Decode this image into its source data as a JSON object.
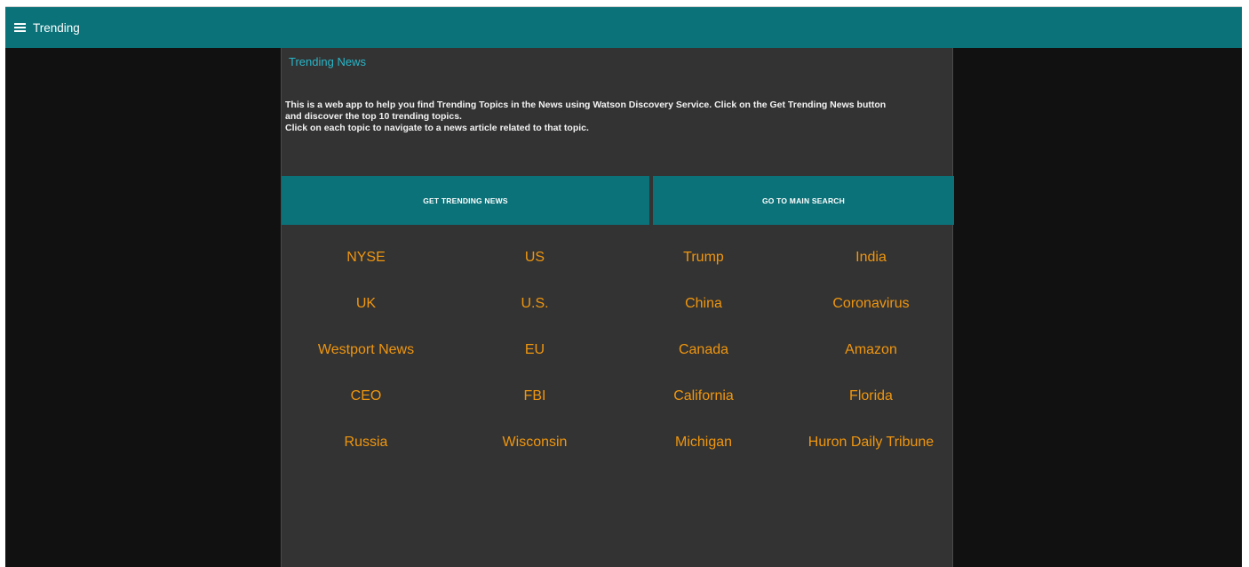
{
  "appbar": {
    "title": "Trending"
  },
  "panel": {
    "title": "Trending News",
    "description": [
      "This is a web app to help you find Trending Topics in the News using Watson Discovery Service. Click on the Get Trending News button",
      "and discover the top 10 trending topics.",
      "Click on each topic to navigate to a news article related to that topic."
    ],
    "buttons": {
      "get_trending": "GET TRENDING NEWS",
      "main_search": "GO TO MAIN SEARCH"
    },
    "topics": [
      "NYSE",
      "US",
      "Trump",
      "India",
      "UK",
      "U.S.",
      "China",
      "Coronavirus",
      "Westport News",
      "EU",
      "Canada",
      "Amazon",
      "CEO",
      "FBI",
      "California",
      "Florida",
      "Russia",
      "Wisconsin",
      "Michigan",
      "Huron Daily Tribune"
    ]
  },
  "colors": {
    "appbar": "#0b7279",
    "panel_bg": "#333333",
    "page_bg": "#111111",
    "topic_text": "#f0960e",
    "title_text": "#29b6c8"
  },
  "icons": {
    "menu": "hamburger-menu-icon"
  }
}
